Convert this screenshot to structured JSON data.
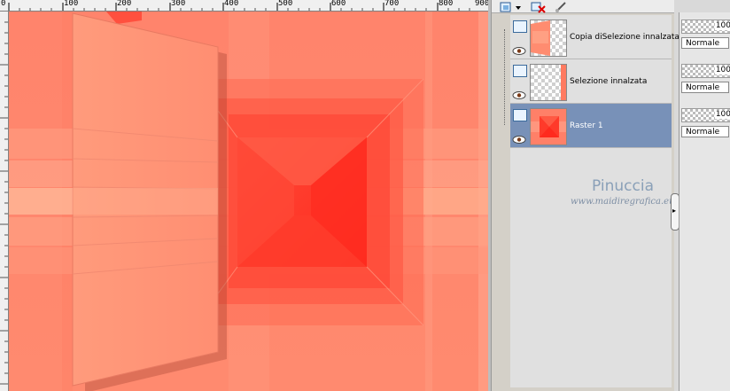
{
  "ruler": {
    "labels": [
      "0",
      "100",
      "200",
      "300",
      "400",
      "500",
      "600",
      "700",
      "800",
      "900"
    ]
  },
  "layers_toolbar": {
    "icons": [
      "new-layer-icon",
      "delete-layer-icon",
      "edit-mask-icon"
    ]
  },
  "layers": [
    {
      "name": "Copia diSelezione innalzata",
      "selected": false,
      "opacity": "100",
      "blend": "Normale"
    },
    {
      "name": "Selezione innalzata",
      "selected": false,
      "opacity": "100",
      "blend": "Normale"
    },
    {
      "name": "Raster 1",
      "selected": true,
      "opacity": "100",
      "blend": "Normale"
    }
  ],
  "watermark": {
    "title": "Pinuccia",
    "url": "www.maidiregrafica.eu"
  },
  "colors": {
    "canvas_base": "#ff8a70",
    "canvas_center": "#ff3a2a",
    "selected_layer": "#7891b8"
  }
}
